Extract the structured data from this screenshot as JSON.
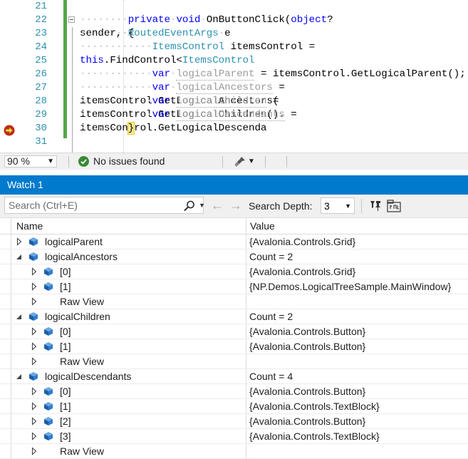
{
  "editor": {
    "lines": [
      {
        "num": "21"
      },
      {
        "num": "22"
      },
      {
        "num": "23"
      },
      {
        "num": "24"
      },
      {
        "num": "25"
      },
      {
        "num": "26"
      },
      {
        "num": "27"
      },
      {
        "num": "28"
      },
      {
        "num": "29"
      },
      {
        "num": "30"
      },
      {
        "num": "31"
      }
    ],
    "tokens": {
      "l22_private": "private",
      "l22_void": "void",
      "l22_name": "OnButtonClick(",
      "l22_object": "object",
      "l22_sender": "? sender,",
      "l22_routed": "RoutedEventArgs",
      "l22_e": "e",
      "l23_brace": "{",
      "l24_type": "ItemsControl",
      "l24_rest": " itemsControl = ",
      "l24_this": "this",
      "l24_find": ".FindControl<",
      "l24_type2": "ItemsControl",
      "l26_var": "var",
      "l26_name": "logicalParent",
      "l26_rest": " = itemsControl.GetLogicalParent();",
      "l27_var": "var",
      "l27_name": "logicalAncestors",
      "l27_rest": " = itemsControl.GetLogicalAncestors(",
      "l28_var": "var",
      "l28_name": "logicalChildren",
      "l28_rest": " = itemsControl.GetLogicalChildren().",
      "l29_var": "var",
      "l29_name": "logicalDescendants",
      "l29_rest": " = itemsControl.GetLogicalDescenda",
      "l30_brace": "}"
    }
  },
  "status": {
    "zoom": "90 %",
    "issues": "No issues found"
  },
  "watch": {
    "title": "Watch 1",
    "search_placeholder": "Search (Ctrl+E)",
    "search_depth_label": "Search Depth:",
    "search_depth_value": "3",
    "col_name": "Name",
    "col_value": "Value",
    "rows": [
      {
        "name": "logicalParent",
        "value": "{Avalonia.Controls.Grid}"
      },
      {
        "name": "logicalAncestors",
        "value": "Count = 2"
      },
      {
        "name": "[0]",
        "value": "{Avalonia.Controls.Grid}"
      },
      {
        "name": "[1]",
        "value": "{NP.Demos.LogicalTreeSample.MainWindow}"
      },
      {
        "name": "Raw View",
        "value": ""
      },
      {
        "name": "logicalChildren",
        "value": "Count = 2"
      },
      {
        "name": "[0]",
        "value": "{Avalonia.Controls.Button}"
      },
      {
        "name": "[1]",
        "value": "{Avalonia.Controls.Button}"
      },
      {
        "name": "Raw View",
        "value": ""
      },
      {
        "name": "logicalDescendants",
        "value": "Count = 4"
      },
      {
        "name": "[0]",
        "value": "{Avalonia.Controls.Button}"
      },
      {
        "name": "[1]",
        "value": "{Avalonia.Controls.TextBlock}"
      },
      {
        "name": "[2]",
        "value": "{Avalonia.Controls.Button}"
      },
      {
        "name": "[3]",
        "value": "{Avalonia.Controls.TextBlock}"
      },
      {
        "name": "Raw View",
        "value": ""
      }
    ]
  }
}
